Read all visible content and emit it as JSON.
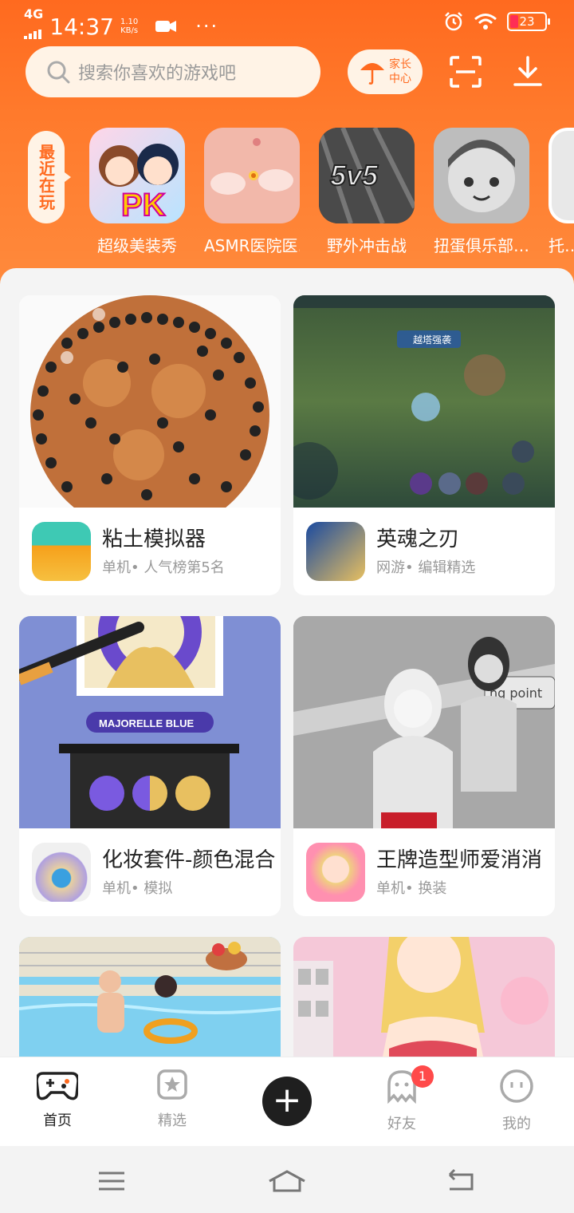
{
  "status_bar": {
    "network": "4G",
    "time": "14:37",
    "speed_value": "1.10",
    "speed_unit": "KB/s",
    "battery": "23"
  },
  "header": {
    "search_placeholder": "搜索你喜欢的游戏吧",
    "parent_center_line1": "家长",
    "parent_center_line2": "中心"
  },
  "recent": {
    "label": "最近在玩",
    "games": [
      {
        "name": "超级美装秀"
      },
      {
        "name": "ASMR医院医…"
      },
      {
        "name": "野外冲击战"
      },
      {
        "name": "扭蛋俱乐部…"
      },
      {
        "name": "托…"
      }
    ]
  },
  "cards": [
    {
      "title": "粘土模拟器",
      "sub": "单机• 人气榜第5名"
    },
    {
      "title": "英魂之刃",
      "sub": "网游• 编辑精选"
    },
    {
      "title": "化妆套件-颜色混合",
      "sub": "单机• 模拟",
      "art_text": "MAJORELLE BLUE"
    },
    {
      "title": "王牌造型师爱消消",
      "sub": "单机• 换装"
    }
  ],
  "card_art_text": {
    "game2_hud": "越塔强袭",
    "game4_sign": "ng point"
  },
  "bottom_nav": {
    "home": "首页",
    "featured": "精选",
    "friends": "好友",
    "friends_badge": "1",
    "me": "我的"
  },
  "colors": {
    "brand_orange": "#ff6a1f",
    "badge_red": "#ff4a4a"
  }
}
